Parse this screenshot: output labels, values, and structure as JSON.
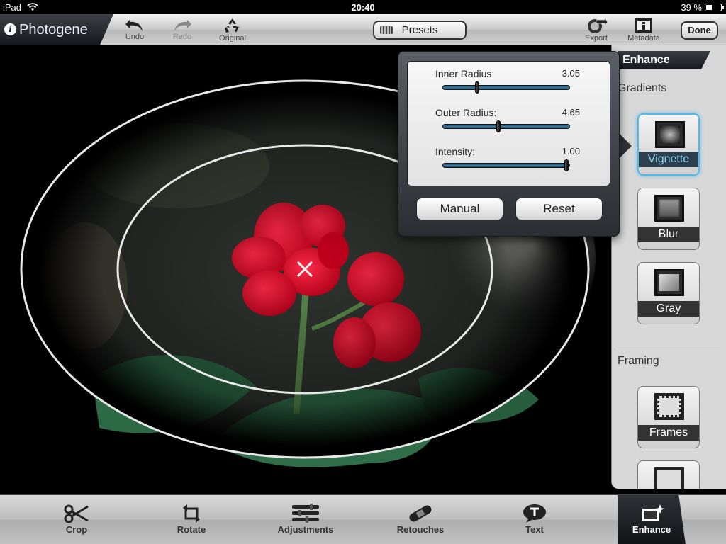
{
  "status_bar": {
    "carrier": "iPad",
    "time": "20:40",
    "battery": "39 %",
    "battery_level": 0.39
  },
  "app": {
    "name": "Photogene",
    "info_glyph": "i"
  },
  "toolbar": {
    "undo": "Undo",
    "redo": "Redo",
    "original": "Original",
    "presets": "Presets",
    "export": "Export",
    "metadata": "Metadata",
    "done": "Done"
  },
  "popover": {
    "sliders": [
      {
        "label": "Inner Radius:",
        "value": "3.05",
        "fraction": 0.27
      },
      {
        "label": "Outer Radius:",
        "value": "4.65",
        "fraction": 0.44
      },
      {
        "label": "Intensity:",
        "value": "1.00",
        "fraction": 0.98
      }
    ],
    "manual": "Manual",
    "reset": "Reset"
  },
  "sidebar": {
    "tab": "Enhance",
    "gradients_heading": "Gradients",
    "framing_heading": "Framing",
    "tiles": [
      {
        "label": "Vignette",
        "icon": "vignette-icon",
        "selected": true
      },
      {
        "label": "Blur",
        "icon": "blur-icon",
        "selected": false
      },
      {
        "label": "Gray",
        "icon": "gray-icon",
        "selected": false
      },
      {
        "label": "Frames",
        "icon": "frames-icon",
        "selected": false
      }
    ]
  },
  "tabbar": {
    "tabs": [
      {
        "label": "Crop",
        "icon": "scissors-icon"
      },
      {
        "label": "Rotate",
        "icon": "rotate-icon"
      },
      {
        "label": "Adjustments",
        "icon": "sliders-icon"
      },
      {
        "label": "Retouches",
        "icon": "bandage-icon"
      },
      {
        "label": "Text",
        "icon": "text-bubble-icon"
      },
      {
        "label": "Enhance",
        "icon": "enhance-icon",
        "active": true
      }
    ]
  },
  "colors": {
    "accent": "#57b8e8",
    "flower": "#e0102a",
    "leaf": "#2f6e48"
  }
}
